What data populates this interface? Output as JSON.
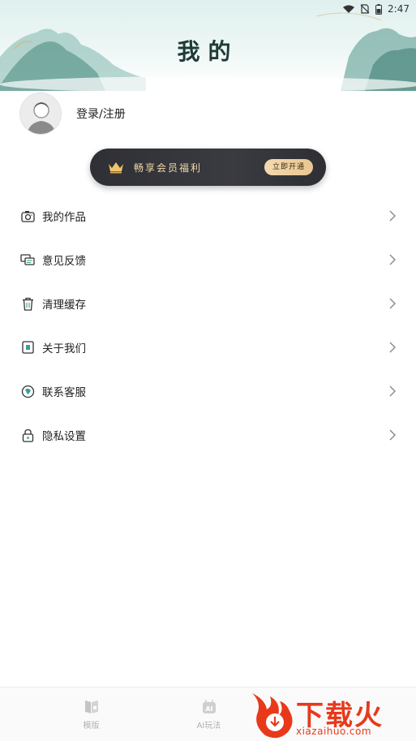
{
  "status_bar": {
    "time": "2:47"
  },
  "header": {
    "title": "我的"
  },
  "profile": {
    "login_label": "登录/注册"
  },
  "vip_banner": {
    "text": "畅享会员福利",
    "button_label": "立即开通",
    "accent": "#f0d9a8"
  },
  "menu": {
    "items": [
      {
        "label": "我的作品",
        "icon": "camera-icon"
      },
      {
        "label": "意见反馈",
        "icon": "feedback-icon"
      },
      {
        "label": "清理缓存",
        "icon": "trash-icon"
      },
      {
        "label": "关于我们",
        "icon": "info-book-icon"
      },
      {
        "label": "联系客服",
        "icon": "customer-service-icon"
      },
      {
        "label": "隐私设置",
        "icon": "lock-icon"
      }
    ]
  },
  "bottom_nav": {
    "items": [
      {
        "label": "模版",
        "icon": "template-icon"
      },
      {
        "label": "AI玩法",
        "icon": "ai-icon"
      }
    ]
  },
  "watermark": {
    "brand": "下载火",
    "url": "xiazaihuo.com",
    "color": "#e8391b"
  }
}
